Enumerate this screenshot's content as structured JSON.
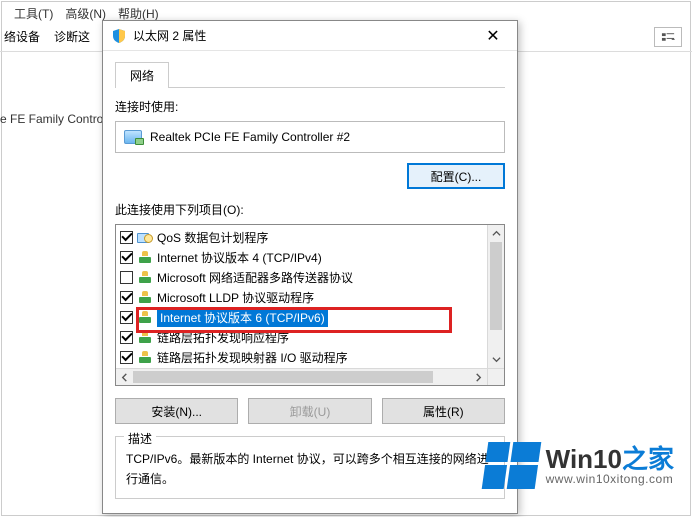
{
  "bg": {
    "menu": {
      "tools": "工具(T)",
      "advanced": "高级(N)",
      "help": "帮助(H)"
    },
    "toolbar": {
      "item1": "络设备",
      "item2": "诊断这"
    },
    "list_item": "e FE Family Controlle"
  },
  "dialog": {
    "title": "以太网 2 属性",
    "tab_network": "网络",
    "connect_using_label": "连接时使用:",
    "adapter_name": "Realtek PCIe FE Family Controller #2",
    "configure_btn": "配置(C)...",
    "items_label": "此连接使用下列项目(O):",
    "items": [
      {
        "checked": true,
        "icon": "qos",
        "label": "QoS 数据包计划程序"
      },
      {
        "checked": true,
        "icon": "net",
        "label": "Internet 协议版本 4 (TCP/IPv4)"
      },
      {
        "checked": false,
        "icon": "net",
        "label": "Microsoft 网络适配器多路传送器协议"
      },
      {
        "checked": true,
        "icon": "net",
        "label": "Microsoft LLDP 协议驱动程序"
      },
      {
        "checked": true,
        "icon": "net",
        "label": "Internet 协议版本 6 (TCP/IPv6)",
        "selected": true
      },
      {
        "checked": true,
        "icon": "net",
        "label": "链路层拓扑发现响应程序"
      },
      {
        "checked": true,
        "icon": "net",
        "label": "链路层拓扑发现映射器 I/O 驱动程序"
      }
    ],
    "install_btn": "安装(N)...",
    "uninstall_btn": "卸载(U)",
    "properties_btn": "属性(R)",
    "desc_legend": "描述",
    "desc_text": "TCP/IPv6。最新版本的 Internet 协议，可以跨多个相互连接的网络进行通信。"
  },
  "watermark": {
    "brand_a": "Win10",
    "brand_b": "之家",
    "url": "www.win10xitong.com"
  }
}
